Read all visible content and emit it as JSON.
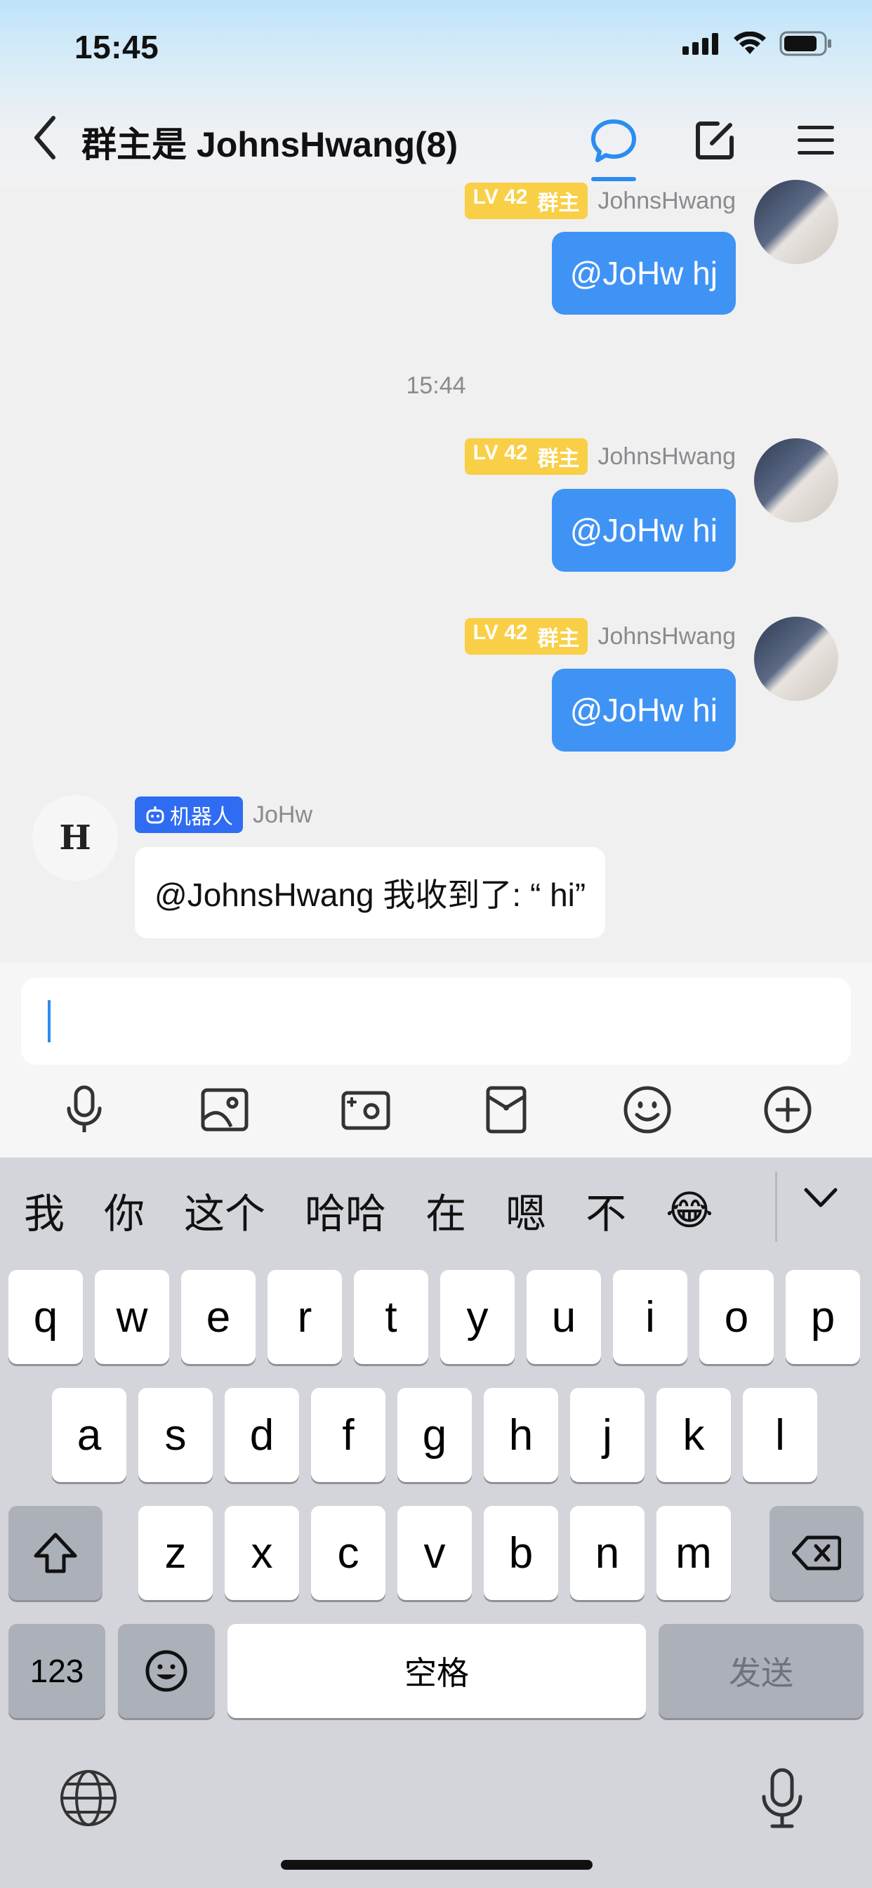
{
  "status": {
    "time": "15:45"
  },
  "nav": {
    "title": "群主是 JohnsHwang(8)"
  },
  "messages": {
    "m1": {
      "level": "LV 42",
      "role": "群主",
      "sender": "JohnsHwang",
      "text": "@JoHw hj"
    },
    "divider_time": "15:44",
    "m2": {
      "level": "LV 42",
      "role": "群主",
      "sender": "JohnsHwang",
      "text": "@JoHw hi"
    },
    "m3": {
      "level": "LV 42",
      "role": "群主",
      "sender": "JohnsHwang",
      "text": "@JoHw hi"
    },
    "bot": {
      "badge": "机器人",
      "sender": "JoHw",
      "avatar_letter": "H",
      "text": "@JohnsHwang 我收到了: “ hi”"
    }
  },
  "input": {
    "value": ""
  },
  "keyboard": {
    "candidates": [
      "我",
      "你",
      "这个",
      "哈哈",
      "在",
      "嗯",
      "不",
      "😂"
    ],
    "row1": [
      "q",
      "w",
      "e",
      "r",
      "t",
      "y",
      "u",
      "i",
      "o",
      "p"
    ],
    "row2": [
      "a",
      "s",
      "d",
      "f",
      "g",
      "h",
      "j",
      "k",
      "l"
    ],
    "row3": [
      "z",
      "x",
      "c",
      "v",
      "b",
      "n",
      "m"
    ],
    "numbers": "123",
    "space": "空格",
    "send": "发送"
  },
  "colors": {
    "accent": "#2a8df0",
    "bubble_out": "#3f93f5",
    "level_badge": "#f8cf46",
    "bot_badge": "#2f6cf2"
  }
}
